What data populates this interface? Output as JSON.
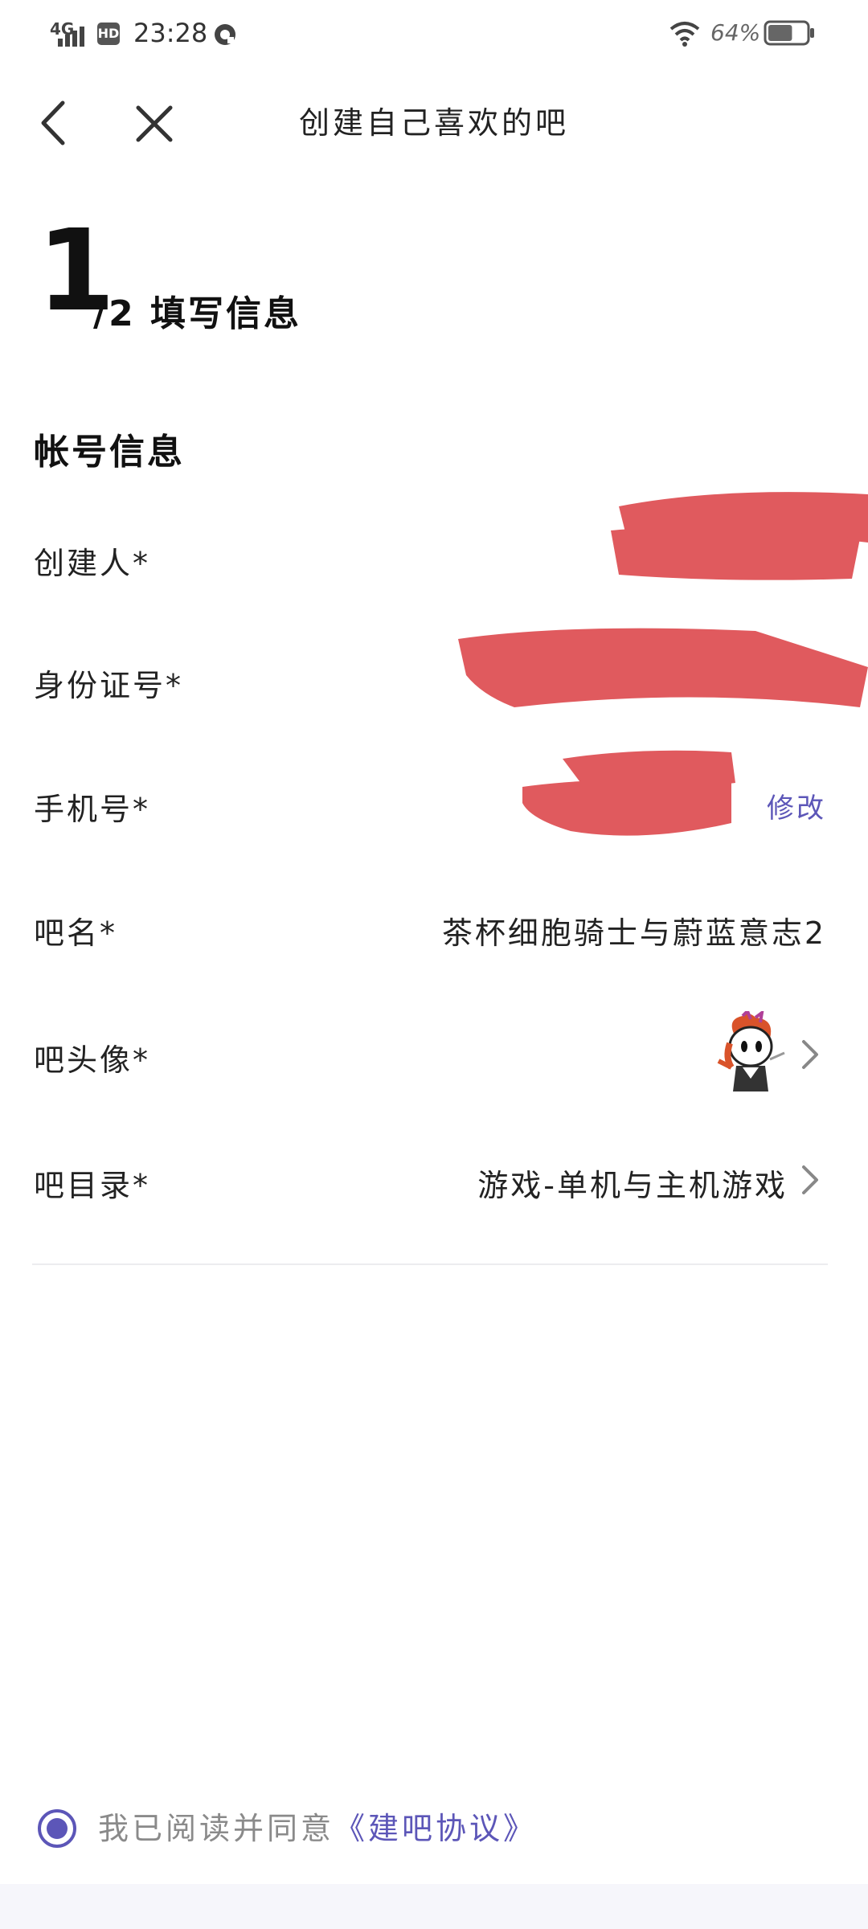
{
  "status_bar": {
    "network": "4G",
    "hd": "HD",
    "time": "23:28",
    "battery_percent": "64%",
    "battery_level": 0.64
  },
  "nav": {
    "title": "创建自己喜欢的吧",
    "back_icon": "chevron-left-icon",
    "close_icon": "close-icon"
  },
  "step": {
    "current": "1",
    "rest": "/2 填写信息"
  },
  "section": {
    "title": "帐号信息"
  },
  "rows": {
    "creator": {
      "label": "创建人*"
    },
    "id_number": {
      "label": "身份证号*"
    },
    "phone": {
      "label": "手机号*",
      "action": "修改"
    },
    "bar_name": {
      "label": "吧名*",
      "value": "茶杯细胞骑士与蔚蓝意志2"
    },
    "bar_avatar": {
      "label": "吧头像*"
    },
    "bar_category": {
      "label": "吧目录*",
      "value": "游戏-单机与主机游戏"
    }
  },
  "agreement": {
    "text": "我已阅读并同意",
    "link": "《建吧协议》",
    "checked": true
  },
  "colors": {
    "accent": "#5c56b8",
    "redaction": "#e05a5e"
  }
}
